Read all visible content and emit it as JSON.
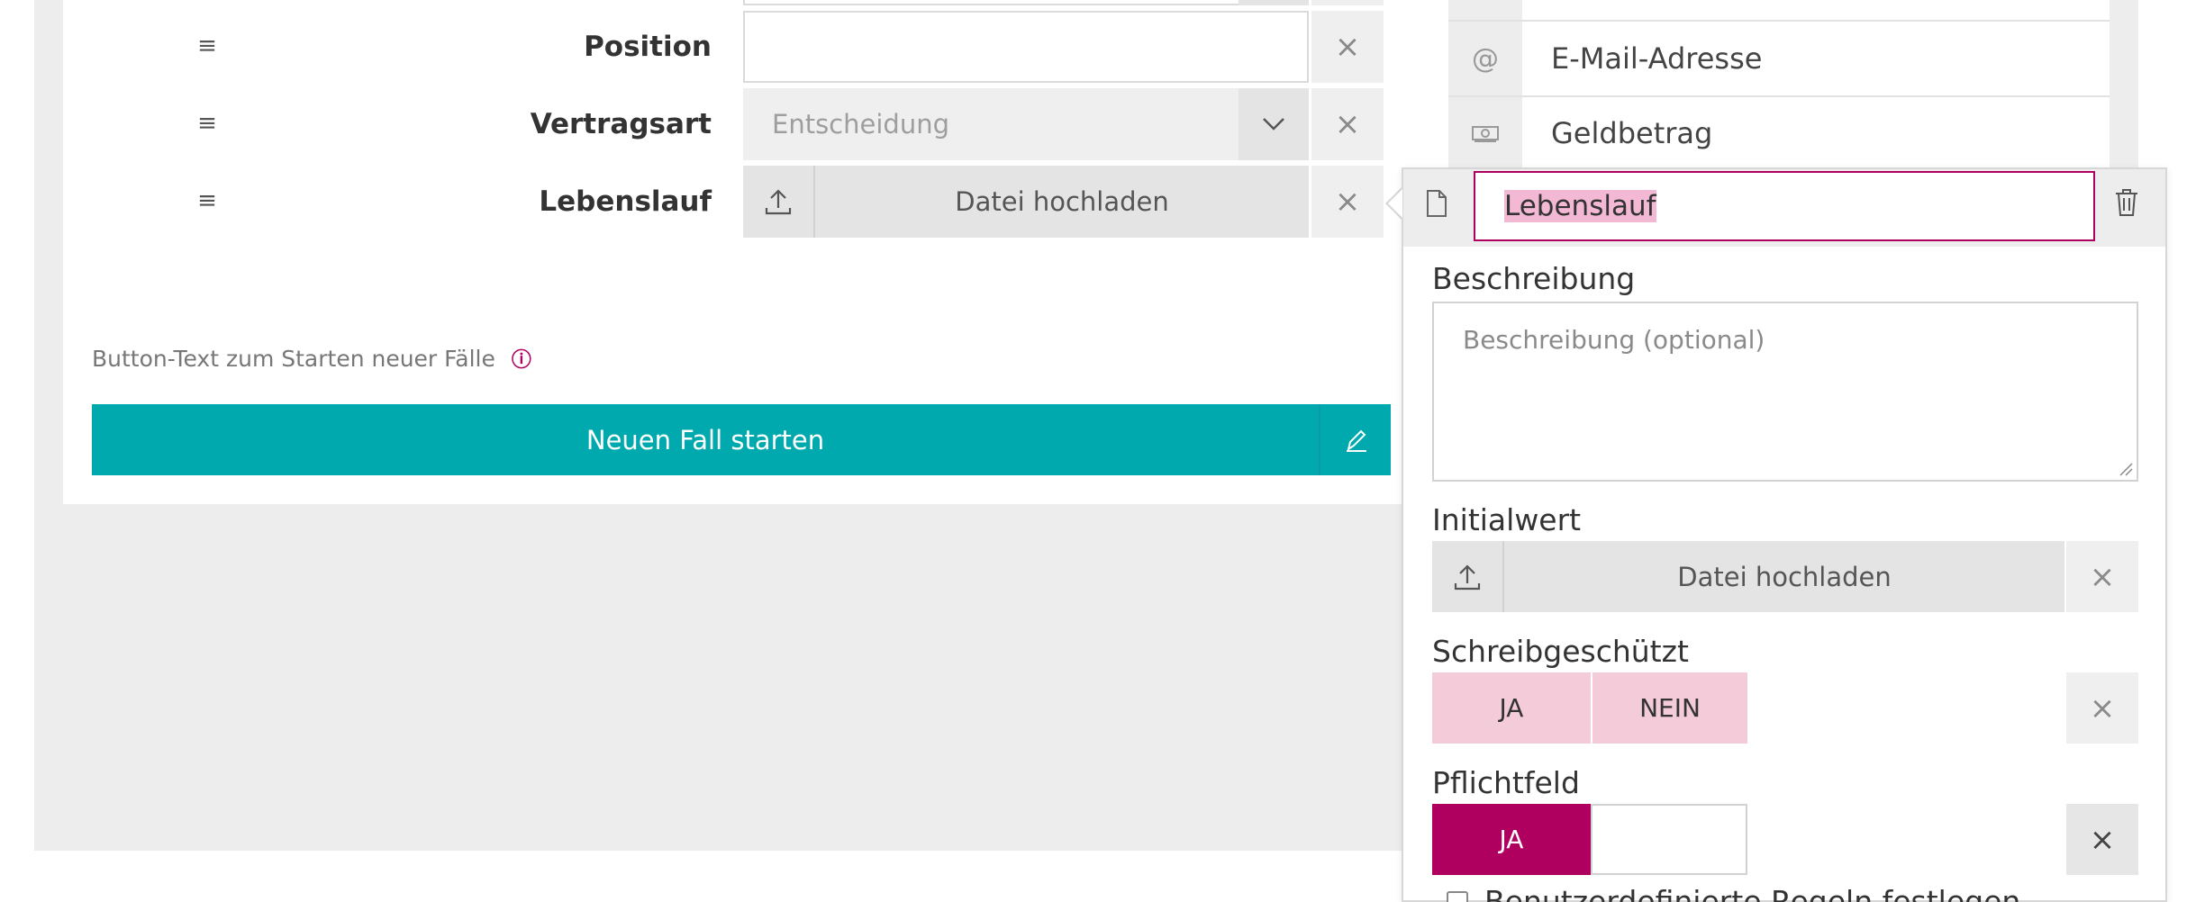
{
  "form": {
    "rows": [
      {
        "label": "Position",
        "type": "text",
        "value": ""
      },
      {
        "label": "Vertragsart",
        "type": "select",
        "placeholder": "Entscheidung"
      },
      {
        "label": "Lebenslauf",
        "type": "upload",
        "upload_label": "Datei hochladen"
      }
    ],
    "button_text_label": "Button-Text zum Starten neuer Fälle",
    "start_button_label": "Neuen Fall starten"
  },
  "field_list": {
    "items": [
      {
        "icon": "at-icon",
        "label": "E-Mail-Adresse"
      },
      {
        "icon": "money-icon",
        "label": "Geldbetrag"
      }
    ]
  },
  "popover": {
    "field_name": "Lebenslauf",
    "description_label": "Beschreibung",
    "description_placeholder": "Beschreibung (optional)",
    "initial_value_label": "Initialwert",
    "upload_label": "Datei hochladen",
    "readonly_label": "Schreibgeschützt",
    "readonly_yes": "JA",
    "readonly_no": "NEIN",
    "required_label": "Pflichtfeld",
    "required_yes": "JA",
    "custom_rules_label": "Benutzerdefinierte Regeln festlegen"
  },
  "colors": {
    "accent": "#b0005f",
    "teal": "#00a9ad",
    "pink_light": "#f4cbd8"
  }
}
